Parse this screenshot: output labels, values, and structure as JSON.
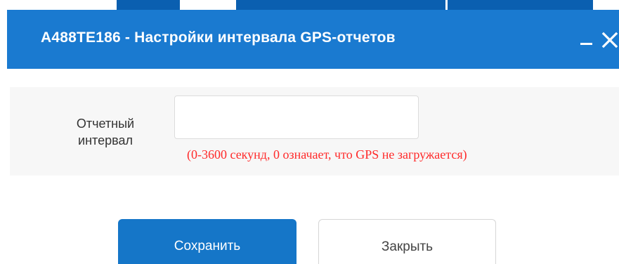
{
  "dialog": {
    "title": "A488TE186 - Настройки интервала GPS-отчетов",
    "minimize_icon": "minimize-icon",
    "close_icon": "close-icon",
    "title_bar_color": "#1a7ad0"
  },
  "form": {
    "interval_label": "Отчетный интервал",
    "interval_value": "",
    "hint": "(0-3600 секунд, 0 означает, что GPS не загружается)",
    "hint_color": "#ff2a2a"
  },
  "buttons": {
    "save_label": "Сохранить",
    "close_label": "Закрыть",
    "primary_color": "#1576c8"
  }
}
